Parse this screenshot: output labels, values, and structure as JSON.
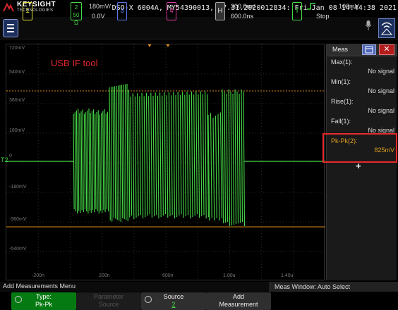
{
  "header": {
    "brand": "KEYSIGHT",
    "brand_sub": "TECHNOLOGIES",
    "device_info": "DSO-X 6004A, MY54390013, 07.31.2020012834: Fri Jan 08 14:44:38 2021"
  },
  "channels": {
    "ch1": {
      "number": "1",
      "color": "#e5e23a"
    },
    "ch2": {
      "number": "2",
      "scale": "180mV/",
      "offset": "0.0V",
      "impedance": "50 Ω",
      "color": "#46d946"
    },
    "ch3": {
      "number": "3",
      "color": "#5b78e6"
    },
    "ch4": {
      "number": "4",
      "color": "#e03aa0"
    },
    "horizontal": {
      "label": "H",
      "scale": "200.0ns/",
      "position": "600.0ns"
    },
    "trigger": {
      "label": "T",
      "level": "100mV",
      "state": "Stop"
    }
  },
  "annotation": "USB IF tool",
  "graticule": {
    "y_labels": [
      "720mV",
      "540mV",
      "360mV",
      "180mV",
      "0",
      "-180mV",
      "-360mV",
      "-540mV"
    ],
    "x_labels": [
      "-200n",
      "200n",
      "600n",
      "1.00u",
      "1.40u"
    ]
  },
  "measurements": {
    "title": "Meas",
    "items": [
      {
        "label": "Max(1):",
        "value": "No signal"
      },
      {
        "label": "Min(1):",
        "value": "No signal"
      },
      {
        "label": "Rise(1):",
        "value": "No signal"
      },
      {
        "label": "Fall(1):",
        "value": "No signal"
      },
      {
        "label": "Pk-Pk(2):",
        "value": "825mV"
      }
    ],
    "add_symbol": "+"
  },
  "status": {
    "left": "Add Measurements Menu",
    "right": "Meas Window: Auto Select"
  },
  "softkeys": {
    "type_label": "Type:",
    "type_value": "Pk-Pk",
    "param_label": "Parameter",
    "param_value": "Source",
    "source_label": "Source",
    "source_value": "2",
    "add_label": "Add",
    "add_value": "Measurement"
  },
  "colors": {
    "trace": "#46d946",
    "measure_line": "#d98a1a",
    "highlight": "#e8282a"
  }
}
